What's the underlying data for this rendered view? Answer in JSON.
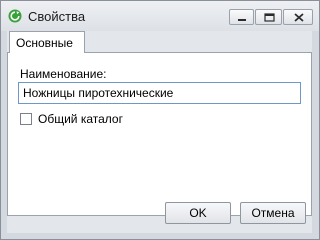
{
  "window": {
    "title": "Свойства"
  },
  "tabs": [
    {
      "label": "Основные",
      "active": true
    }
  ],
  "form": {
    "name_label": "Наименование:",
    "name_value": "Ножницы пиротехнические",
    "common_catalog_label": "Общий каталог",
    "common_catalog_checked": false
  },
  "buttons": {
    "ok": "OK",
    "cancel": "Отмена"
  },
  "colors": {
    "app_icon": "#3aa13a",
    "input_border": "#6f98c8"
  }
}
